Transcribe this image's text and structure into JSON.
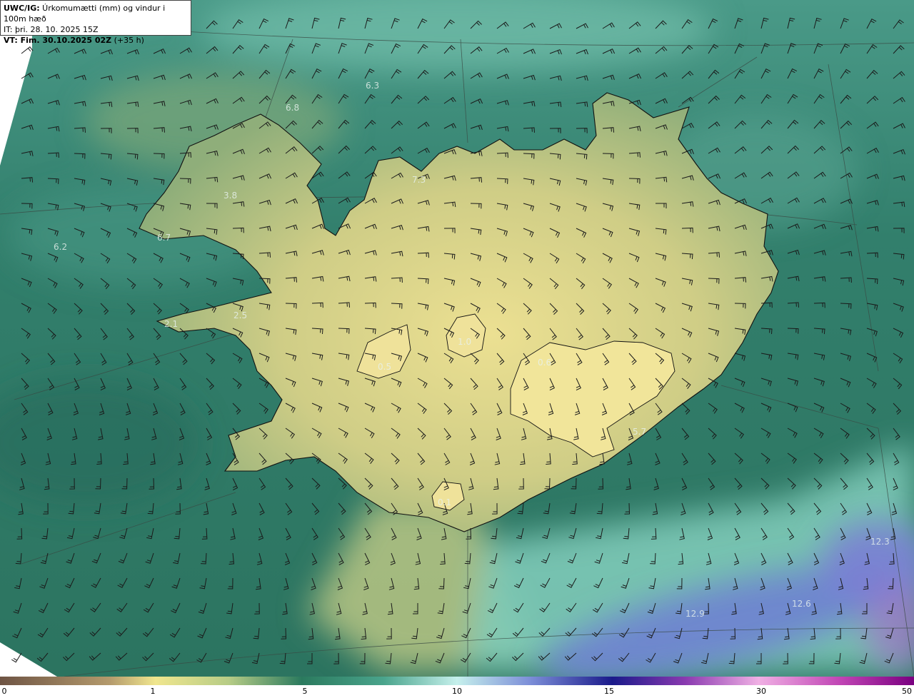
{
  "header": {
    "title_bold": "UWC/IG:",
    "title_rest": " Úrkomumætti (mm) og vindur i 100m hæð",
    "init_time": "IT: þri. 28. 10. 2025 15Z",
    "valid_bold": "VT: Fim. 30.10.2025 02Z",
    "valid_rest": " (+35 h)"
  },
  "map": {
    "region": "Iceland",
    "point_values": [
      "6.3",
      "6.8",
      "7.3",
      "3.8",
      "6.7",
      "6.2",
      "2.5",
      "2.1",
      "1.0",
      "0.6",
      "0.5",
      "5.7",
      "0.1",
      "12.3",
      "12.6",
      "12.9"
    ]
  },
  "colorbar": {
    "ticks": [
      "0",
      "1",
      "5",
      "10",
      "15",
      "30",
      "50"
    ],
    "colors": [
      "#7a5c4a",
      "#b89a6a",
      "#e8e08a",
      "#f0e890",
      "#5fb08a",
      "#2a7a5a",
      "#8fd8c8",
      "#c8f0ec",
      "#6a7ad0",
      "#1a1aa0",
      "#8a3ab0",
      "#f0a0e0",
      "#c040b0",
      "#800080"
    ]
  },
  "colors": {
    "ocean_deep": "#2e7a6a",
    "ocean_light": "#7cc4b4",
    "land_dry": "#e8dc8c",
    "land_mid": "#b8c07a",
    "high_precip": "#6a7ad0"
  }
}
